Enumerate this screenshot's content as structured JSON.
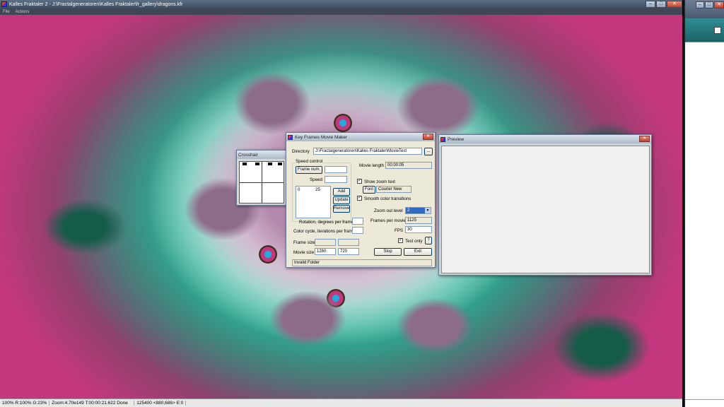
{
  "main_window": {
    "title": "Kalles Fraktaler 2 - J:\\Fractalgeneratoren\\Kalles Fraktaler\\fr_gallery\\dragons.kfr",
    "menu": [
      "File",
      "Actions"
    ],
    "controls": {
      "minimize": "–",
      "maximize": "□",
      "close": "✕"
    }
  },
  "statusbar": {
    "cells": [
      "100% R:100% G:23%",
      "Zoom:4.70e149 T:00:00:21.622 Done",
      "125400 <880,686> E:0"
    ]
  },
  "crosshair": {
    "title": "Crosshair"
  },
  "keyframes": {
    "title": "Key Frames Movie Maker",
    "directory_label": "Directory",
    "directory_value": "J:\\Fractalgeneratoren\\Kalles Fraktaler\\MovieTest",
    "browse_label": "...",
    "speed_group": "Speed control",
    "frame_num_label": "Frame num.",
    "frame_num_value": "",
    "speed_label": "Speed",
    "speed_value": "",
    "list_col1": "0",
    "list_col2": "25",
    "add_label": "Add",
    "update_label": "Update",
    "remove_label": "Remove",
    "movie_length_label": "Movie length",
    "movie_length_value": "00:00:05",
    "show_zoom_text_label": "Show zoom text",
    "font_label": "Font",
    "font_value": "Courier New",
    "smooth_color_label": "Smooth color transitions",
    "zoom_out_label": "Zoom out level",
    "zoom_out_value": "2",
    "frames_per_movie_label": "Frames per movie",
    "frames_per_movie_value": "1125",
    "fps_label": "FPS",
    "fps_value": "30",
    "rotation_label": "Rotation, degrees per frame",
    "rotation_value": "",
    "color_cycle_label": "Color cycle, iterations per frame",
    "color_cycle_value": "",
    "frame_size_label": "Frame size",
    "frame_size_w": "",
    "frame_size_h": "",
    "movie_size_label": "Movie size",
    "movie_size_w": "1280",
    "movie_size_h": "720",
    "test_only_label": "Test only",
    "help_label": "?",
    "stop_label": "Stop",
    "exit_label": "Exit",
    "status": "Invalid Folder",
    "checkmark": "✓"
  },
  "preview": {
    "title": "Preview"
  },
  "colors": {
    "fractal_magenta": "#c2377d",
    "fractal_teal": "#2fb69a",
    "fractal_mauve": "#b489ad",
    "select_blue": "#316ac5"
  }
}
